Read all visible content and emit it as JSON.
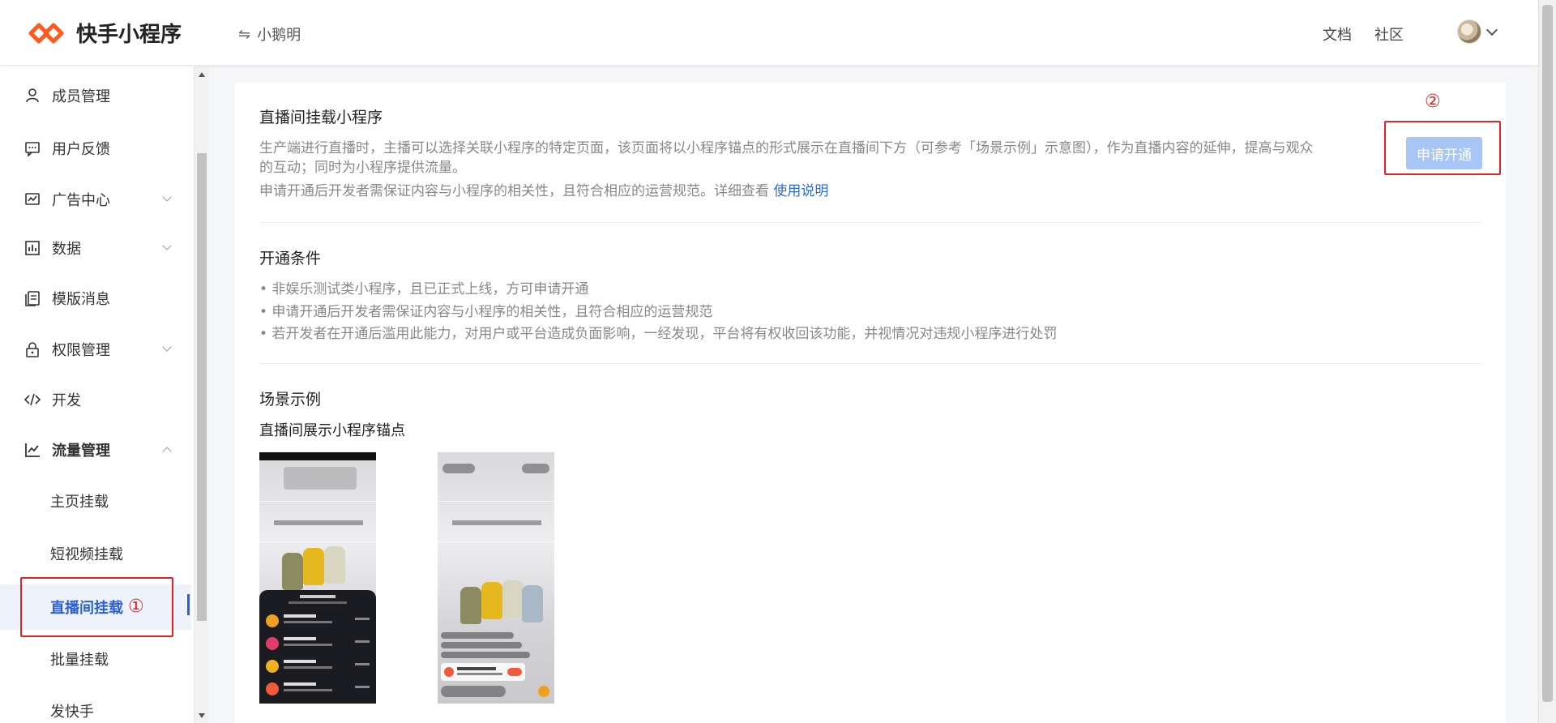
{
  "header": {
    "app_title": "快手小程序",
    "switch_icon": "⇋",
    "current_app": "小鹅明",
    "links": [
      "文档",
      "社区"
    ]
  },
  "sidebar": {
    "items": [
      {
        "label": "成员管理",
        "icon": "user-icon"
      },
      {
        "label": "用户反馈",
        "icon": "message-icon"
      },
      {
        "label": "广告中心",
        "icon": "ad-icon",
        "expandable": true
      },
      {
        "label": "数据",
        "icon": "chart-icon",
        "expandable": true
      },
      {
        "label": "模版消息",
        "icon": "template-icon"
      },
      {
        "label": "权限管理",
        "icon": "lock-icon",
        "expandable": true
      },
      {
        "label": "开发",
        "icon": "code-icon"
      },
      {
        "label": "流量管理",
        "icon": "trend-icon",
        "expanded": true
      }
    ],
    "sub_items": [
      "主页挂载",
      "短视频挂载",
      "直播间挂载",
      "批量挂载",
      "发快手"
    ],
    "active_sub": "直播间挂载"
  },
  "annotations": {
    "one": "①",
    "two": "②"
  },
  "main": {
    "title": "直播间挂载小程序",
    "desc_line1": "生产端进行直播时，主播可以选择关联小程序的特定页面，该页面将以小程序锚点的形式展示在直播间下方（可参考「场景示例」示意图），作为直播内容的延伸，提高与观众",
    "desc_line2": "的互动；同时为小程序提供流量。",
    "desc_line3": "申请开通后开发者需保证内容与小程序的相关性，且符合相应的运营规范。详细查看",
    "desc_link": "使用说明",
    "apply_button": "申请开通",
    "conditions_title": "开通条件",
    "conditions": [
      "• 非娱乐测试类小程序，且已正式上线，方可申请开通",
      "• 申请开通后开发者需保证内容与小程序的相关性，且符合相应的运营规范",
      "• 若开发者在开通后滥用此能力，对用户或平台造成负面影响，一经发现，平台将有权收回该功能，并视情况对违规小程序进行处罚"
    ],
    "scene_title": "场景示例",
    "scene_subtitle": "直播间展示小程序锚点"
  },
  "colors": {
    "accent": "#2b5fd9",
    "annotation_red": "#e02424",
    "button_disabled": "#a8c6f5",
    "logo_orange": "#ff5a1f"
  }
}
